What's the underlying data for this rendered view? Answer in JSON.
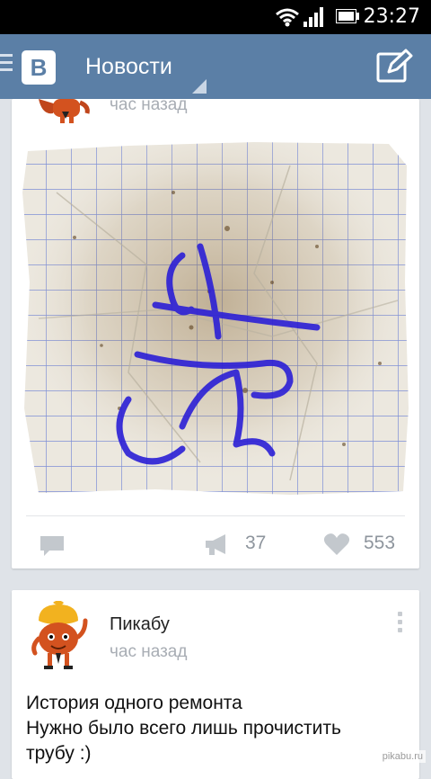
{
  "status_bar": {
    "time": "23:27"
  },
  "app_bar": {
    "logo_letter": "В",
    "title": "Новости"
  },
  "feed": {
    "posts": [
      {
        "author": "",
        "time": "час назад",
        "reposts": "37",
        "likes": "553"
      },
      {
        "author": "Пикабу",
        "time": "час назад",
        "text_lines": [
          "История одного ремонта",
          "Нужно было всего лишь прочистить",
          "трубу :)"
        ]
      }
    ]
  },
  "watermark": "pikabu.ru",
  "colors": {
    "app_bar": "#5b7fa6",
    "background": "#dfe3e8",
    "ink": "#2b1fd6",
    "icon_gray": "#c3c8cd"
  }
}
